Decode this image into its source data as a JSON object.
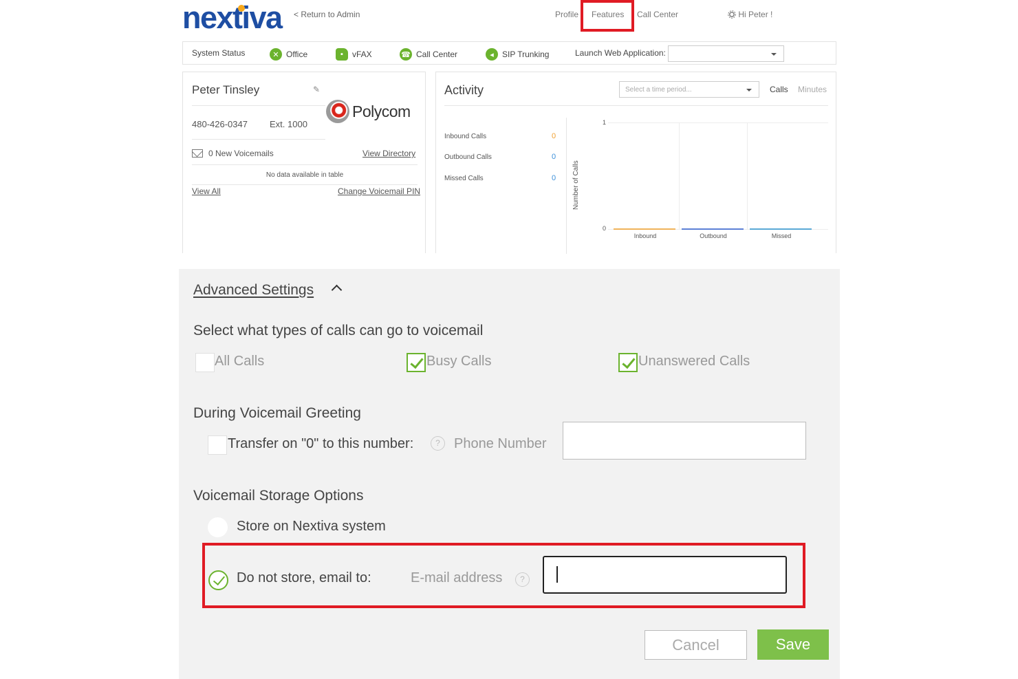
{
  "header": {
    "brand": "nextiva",
    "return_link": "< Return to Admin",
    "nav": {
      "profile": "Profile",
      "features": "Features",
      "call_center": "Call Center",
      "greeting": "Hi Peter !"
    }
  },
  "toolbar": {
    "system_status": "System Status",
    "office": "Office",
    "vfax": "vFAX",
    "call_center": "Call Center",
    "sip_trunking": "SIP Trunking",
    "launch_label": "Launch Web Application:",
    "launch_value": ""
  },
  "profile": {
    "name": "Peter Tinsley",
    "phone": "480-426-0347",
    "ext": "Ext. 1000",
    "device_brand": "Polycom",
    "voicemails": "0 New Voicemails",
    "view_directory": "View Directory",
    "no_data": "No data available in table",
    "view_all": "View All",
    "change_pin": "Change Voicemail PIN"
  },
  "activity": {
    "title": "Activity",
    "time_placeholder": "Select a time period...",
    "tab_calls": "Calls",
    "tab_minutes": "Minutes",
    "stats": [
      {
        "label": "Inbound Calls",
        "value": "0",
        "color": "#f0a030"
      },
      {
        "label": "Outbound Calls",
        "value": "0",
        "color": "#3b8fd9"
      },
      {
        "label": "Missed Calls",
        "value": "0",
        "color": "#3b8fd9"
      }
    ]
  },
  "chart_data": {
    "type": "bar",
    "categories": [
      "Inbound",
      "Outbound",
      "Missed"
    ],
    "values": [
      0,
      0,
      0
    ],
    "colors": [
      "#f0b35a",
      "#5b7fd6",
      "#5aa9d6"
    ],
    "ylabel": "Number of Calls",
    "ylim": [
      0,
      1
    ],
    "yticks": [
      "0",
      "1"
    ]
  },
  "advanced": {
    "title": "Advanced Settings",
    "voicemail_types_title": "Select what types of calls can go to voicemail",
    "call_types": [
      {
        "label": "All Calls",
        "checked": false
      },
      {
        "label": "Busy Calls",
        "checked": true
      },
      {
        "label": "Unanswered Calls",
        "checked": true
      }
    ],
    "greeting_title": "During Voicemail Greeting",
    "transfer_label": "Transfer on \"0\" to this number:",
    "phone_label": "Phone Number",
    "phone_value": "",
    "storage_title": "Voicemail Storage Options",
    "store_option": "Store on Nextiva system",
    "email_option": "Do not store, email to:",
    "email_label": "E-mail address",
    "email_value": "",
    "cancel": "Cancel",
    "save": "Save"
  }
}
